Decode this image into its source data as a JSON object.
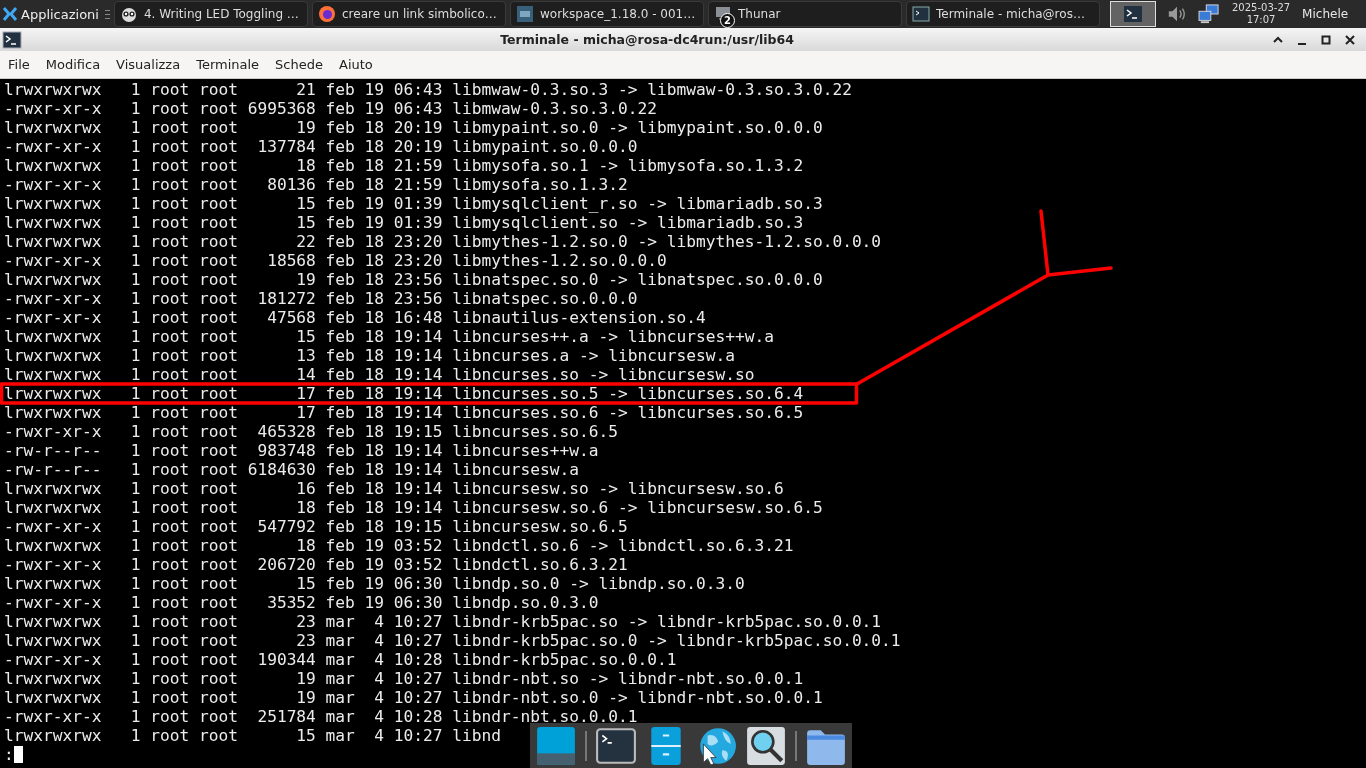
{
  "panel": {
    "apps_menu": "Applicazioni",
    "tasks": [
      {
        "label": "4. Writing LED Toggling …",
        "kind": "owl"
      },
      {
        "label": "creare un link simbolico…",
        "kind": "firefox"
      },
      {
        "label": "workspace_1.18.0 - 001…",
        "kind": "ide"
      },
      {
        "label": "Thunar",
        "kind": "thunar",
        "badge": "2"
      },
      {
        "label": "Terminale - micha@ros…",
        "kind": "terminal"
      }
    ],
    "date": "2025-03-27",
    "time": "17:07",
    "user": "Michele"
  },
  "window": {
    "title": "Terminale - micha@rosa-dc4run:/usr/lib64"
  },
  "menu": [
    "File",
    "Modifica",
    "Visualizza",
    "Terminale",
    "Schede",
    "Aiuto"
  ],
  "lines": [
    "lrwxrwxrwx   1 root root      21 feb 19 06:43 libmwaw-0.3.so.3 -> libmwaw-0.3.so.3.0.22",
    "-rwxr-xr-x   1 root root 6995368 feb 19 06:43 libmwaw-0.3.so.3.0.22",
    "lrwxrwxrwx   1 root root      19 feb 18 20:19 libmypaint.so.0 -> libmypaint.so.0.0.0",
    "-rwxr-xr-x   1 root root  137784 feb 18 20:19 libmypaint.so.0.0.0",
    "lrwxrwxrwx   1 root root      18 feb 18 21:59 libmysofa.so.1 -> libmysofa.so.1.3.2",
    "-rwxr-xr-x   1 root root   80136 feb 18 21:59 libmysofa.so.1.3.2",
    "lrwxrwxrwx   1 root root      15 feb 19 01:39 libmysqlclient_r.so -> libmariadb.so.3",
    "lrwxrwxrwx   1 root root      15 feb 19 01:39 libmysqlclient.so -> libmariadb.so.3",
    "lrwxrwxrwx   1 root root      22 feb 18 23:20 libmythes-1.2.so.0 -> libmythes-1.2.so.0.0.0",
    "-rwxr-xr-x   1 root root   18568 feb 18 23:20 libmythes-1.2.so.0.0.0",
    "lrwxrwxrwx   1 root root      19 feb 18 23:56 libnatspec.so.0 -> libnatspec.so.0.0.0",
    "-rwxr-xr-x   1 root root  181272 feb 18 23:56 libnatspec.so.0.0.0",
    "-rwxr-xr-x   1 root root   47568 feb 18 16:48 libnautilus-extension.so.4",
    "lrwxrwxrwx   1 root root      15 feb 18 19:14 libncurses++.a -> libncurses++w.a",
    "lrwxrwxrwx   1 root root      13 feb 18 19:14 libncurses.a -> libncursesw.a",
    "lrwxrwxrwx   1 root root      14 feb 18 19:14 libncurses.so -> libncursesw.so",
    "lrwxrwxrwx   1 root root      17 feb 18 19:14 libncurses.so.5 -> libncurses.so.6.4",
    "lrwxrwxrwx   1 root root      17 feb 18 19:14 libncurses.so.6 -> libncurses.so.6.5",
    "-rwxr-xr-x   1 root root  465328 feb 18 19:15 libncurses.so.6.5",
    "-rw-r--r--   1 root root  983748 feb 18 19:14 libncurses++w.a",
    "-rw-r--r--   1 root root 6184630 feb 18 19:14 libncursesw.a",
    "lrwxrwxrwx   1 root root      16 feb 18 19:14 libncursesw.so -> libncursesw.so.6",
    "lrwxrwxrwx   1 root root      18 feb 18 19:14 libncursesw.so.6 -> libncursesw.so.6.5",
    "-rwxr-xr-x   1 root root  547792 feb 18 19:15 libncursesw.so.6.5",
    "lrwxrwxrwx   1 root root      18 feb 19 03:52 libndctl.so.6 -> libndctl.so.6.3.21",
    "-rwxr-xr-x   1 root root  206720 feb 19 03:52 libndctl.so.6.3.21",
    "lrwxrwxrwx   1 root root      15 feb 19 06:30 libndp.so.0 -> libndp.so.0.3.0",
    "-rwxr-xr-x   1 root root   35352 feb 19 06:30 libndp.so.0.3.0",
    "lrwxrwxrwx   1 root root      23 mar  4 10:27 libndr-krb5pac.so -> libndr-krb5pac.so.0.0.1",
    "lrwxrwxrwx   1 root root      23 mar  4 10:27 libndr-krb5pac.so.0 -> libndr-krb5pac.so.0.0.1",
    "-rwxr-xr-x   1 root root  190344 mar  4 10:28 libndr-krb5pac.so.0.0.1",
    "lrwxrwxrwx   1 root root      19 mar  4 10:27 libndr-nbt.so -> libndr-nbt.so.0.0.1",
    "lrwxrwxrwx   1 root root      19 mar  4 10:27 libndr-nbt.so.0 -> libndr-nbt.so.0.0.1",
    "-rwxr-xr-x   1 root root  251784 mar  4 10:28 libndr-nbt.so.0.0.1",
    "lrwxrwxrwx   1 root root      15 mar  4 10:27 libnd"
  ],
  "prompt": ":"
}
